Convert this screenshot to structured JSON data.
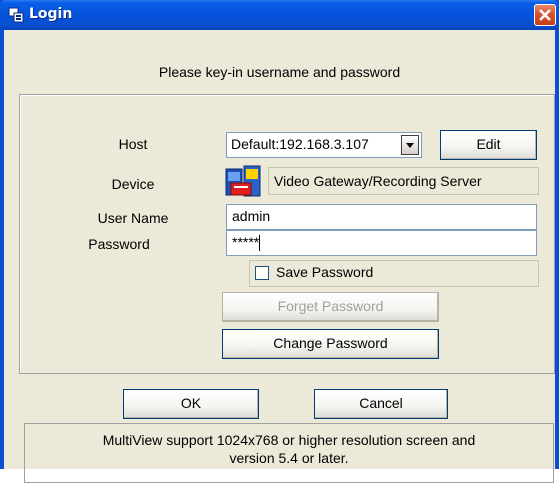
{
  "window": {
    "title": "Login"
  },
  "form": {
    "heading": "Please key-in username and password",
    "host_label": "Host",
    "host_value": "Default:192.168.3.107",
    "edit_label": "Edit",
    "device_label": "Device",
    "device_value": "Video Gateway/Recording Server",
    "username_label": "User Name",
    "username_value": "admin",
    "password_label": "Password",
    "password_value": "*****",
    "save_password_label": "Save Password",
    "forget_password_label": "Forget Password",
    "change_password_label": "Change Password"
  },
  "buttons": {
    "ok": "OK",
    "cancel": "Cancel"
  },
  "info": {
    "line1": "MultiView support 1024x768 or higher resolution screen and",
    "line2": "version 5.4 or later."
  },
  "colors": {
    "titlebar": "#0553dd",
    "close_button": "#d7542f",
    "face": "#ece9d8"
  },
  "icons": {
    "title": "login-window-icon",
    "device": "video-gateway-icon",
    "close": "close-icon",
    "dropdown": "chevron-down-icon"
  }
}
